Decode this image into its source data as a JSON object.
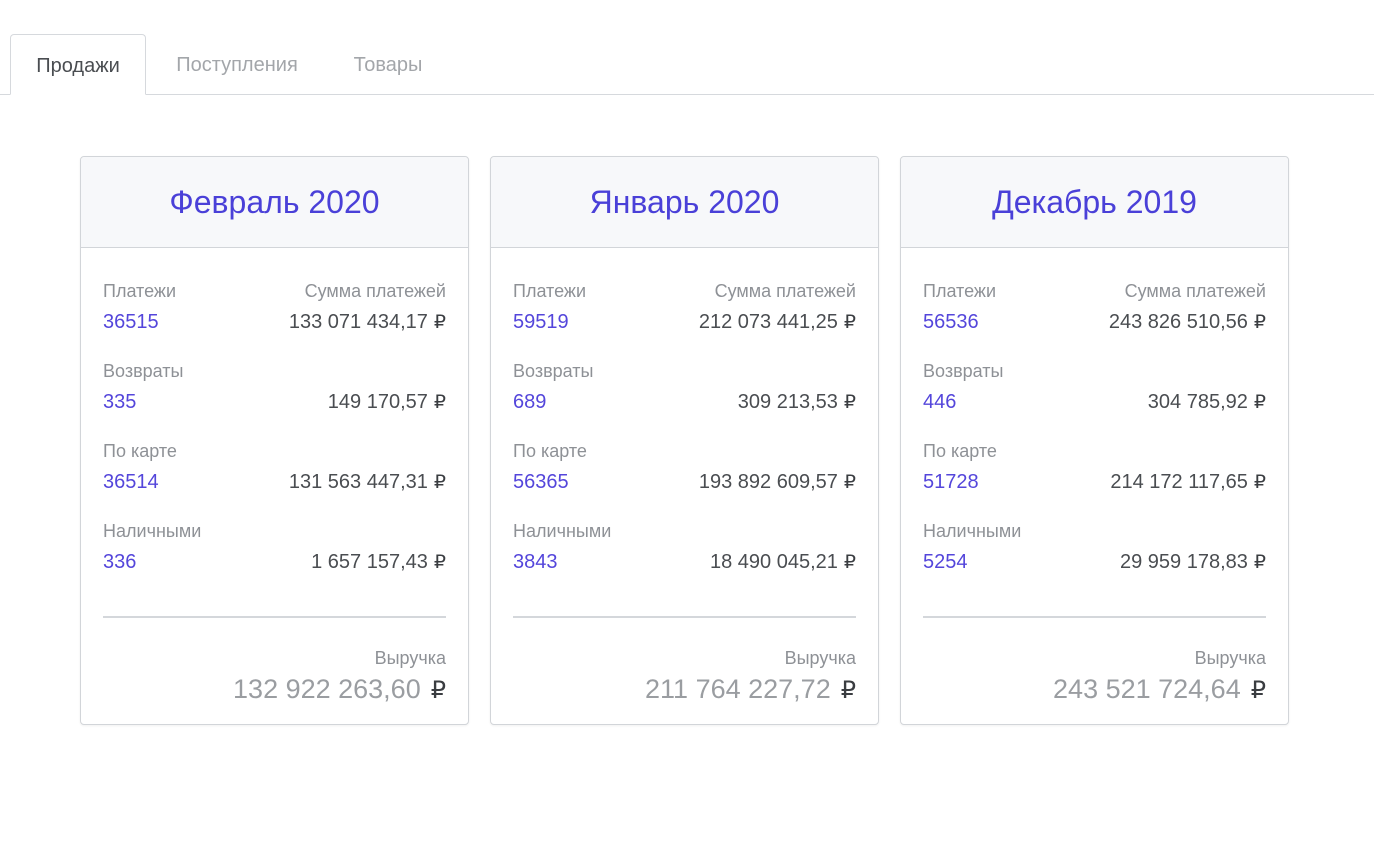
{
  "tabs": [
    {
      "label": "Продажи",
      "active": true
    },
    {
      "label": "Поступления",
      "active": false
    },
    {
      "label": "Товары",
      "active": false
    }
  ],
  "currency_symbol": "₽",
  "colors": {
    "accent": "#4a40d8",
    "count": "#5446db",
    "label": "#8e9196",
    "text": "#4a4d51"
  },
  "cards": [
    {
      "title": "Февраль 2020",
      "payments": {
        "label": "Платежи",
        "sum_label": "Сумма платежей",
        "count": "36515",
        "amount": "133 071 434,17"
      },
      "refunds": {
        "label": "Возвраты",
        "count": "335",
        "amount": "149 170,57"
      },
      "card": {
        "label": "По карте",
        "count": "36514",
        "amount": "131 563 447,31"
      },
      "cash": {
        "label": "Наличными",
        "count": "336",
        "amount": "1 657 157,43"
      },
      "revenue": {
        "label": "Выручка",
        "amount": "132 922 263,60"
      }
    },
    {
      "title": "Январь 2020",
      "payments": {
        "label": "Платежи",
        "sum_label": "Сумма платежей",
        "count": "59519",
        "amount": "212 073 441,25"
      },
      "refunds": {
        "label": "Возвраты",
        "count": "689",
        "amount": "309 213,53"
      },
      "card": {
        "label": "По карте",
        "count": "56365",
        "amount": "193 892 609,57"
      },
      "cash": {
        "label": "Наличными",
        "count": "3843",
        "amount": "18 490 045,21"
      },
      "revenue": {
        "label": "Выручка",
        "amount": "211 764 227,72"
      }
    },
    {
      "title": "Декабрь 2019",
      "payments": {
        "label": "Платежи",
        "sum_label": "Сумма платежей",
        "count": "56536",
        "amount": "243 826 510,56"
      },
      "refunds": {
        "label": "Возвраты",
        "count": "446",
        "amount": "304 785,92"
      },
      "card": {
        "label": "По карте",
        "count": "51728",
        "amount": "214 172 117,65"
      },
      "cash": {
        "label": "Наличными",
        "count": "5254",
        "amount": "29 959 178,83"
      },
      "revenue": {
        "label": "Выручка",
        "amount": "243 521 724,64"
      }
    }
  ]
}
